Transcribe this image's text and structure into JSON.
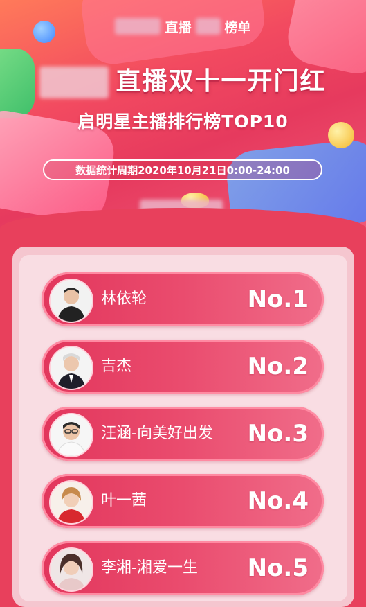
{
  "header": {
    "top_tag_a": "直播",
    "top_tag_b": "榜单",
    "title": "直播双十一开门红",
    "subtitle": "启明星主播排行榜TOP10",
    "period": "数据统计周期2020年10月21日0:00-24:00"
  },
  "ranking": [
    {
      "name": "林依轮",
      "rank": "No.1"
    },
    {
      "name": "吉杰",
      "rank": "No.2"
    },
    {
      "name": "汪涵-向美好出发",
      "rank": "No.3"
    },
    {
      "name": "叶一茜",
      "rank": "No.4"
    },
    {
      "name": "李湘-湘爱一生",
      "rank": "No.5"
    }
  ],
  "colors": {
    "background": "#e8405c",
    "row_gradient_start": "#e2365c",
    "row_gradient_end": "#f06d8a",
    "panel": "#f9dde3"
  }
}
